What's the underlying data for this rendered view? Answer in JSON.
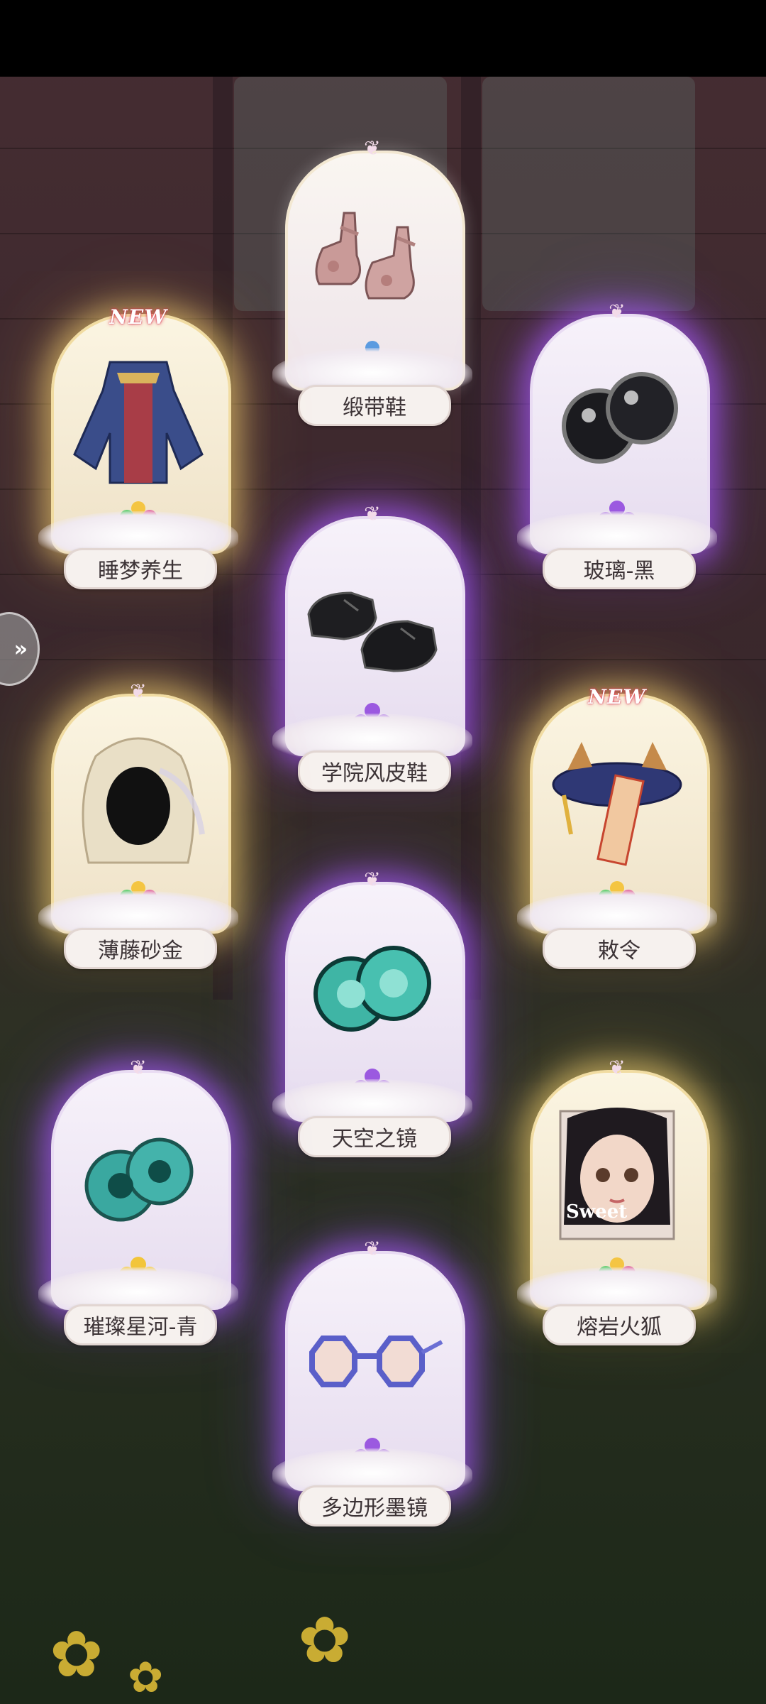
{
  "items": [
    {
      "id": "ribbon-shoes",
      "name": "缎带鞋",
      "glow": "plain",
      "rarity_color": "#5b9be0",
      "is_new": false
    },
    {
      "id": "sleep-dream",
      "name": "睡梦养生",
      "glow": "gold",
      "rarity_color": "rainbow",
      "is_new": true
    },
    {
      "id": "glass-black",
      "name": "玻璃-黑",
      "glow": "purple",
      "rarity_color": "#9b59e0",
      "is_new": false
    },
    {
      "id": "academy-leather-shoes",
      "name": "学院风皮鞋",
      "glow": "purple",
      "rarity_color": "#9b59e0",
      "is_new": false
    },
    {
      "id": "wisteria-gold",
      "name": "薄藤砂金",
      "glow": "gold",
      "rarity_color": "rainbow",
      "is_new": false
    },
    {
      "id": "imperial-order",
      "name": "敕令",
      "glow": "gold",
      "rarity_color": "rainbow",
      "is_new": true
    },
    {
      "id": "sky-mirror",
      "name": "天空之镜",
      "glow": "purple",
      "rarity_color": "#9b59e0",
      "is_new": false
    },
    {
      "id": "starriver-cyan",
      "name": "璀璨星河-青",
      "glow": "purple",
      "rarity_color": "#f2c53a",
      "is_new": false
    },
    {
      "id": "lava-fox",
      "name": "熔岩火狐",
      "glow": "gold",
      "rarity_color": "rainbow",
      "is_new": false,
      "portrait_text": "Sweet"
    },
    {
      "id": "polygon-glasses",
      "name": "多边形墨镜",
      "glow": "purple",
      "rarity_color": "#9b59e0",
      "is_new": false
    }
  ],
  "new_tag": "NEW"
}
